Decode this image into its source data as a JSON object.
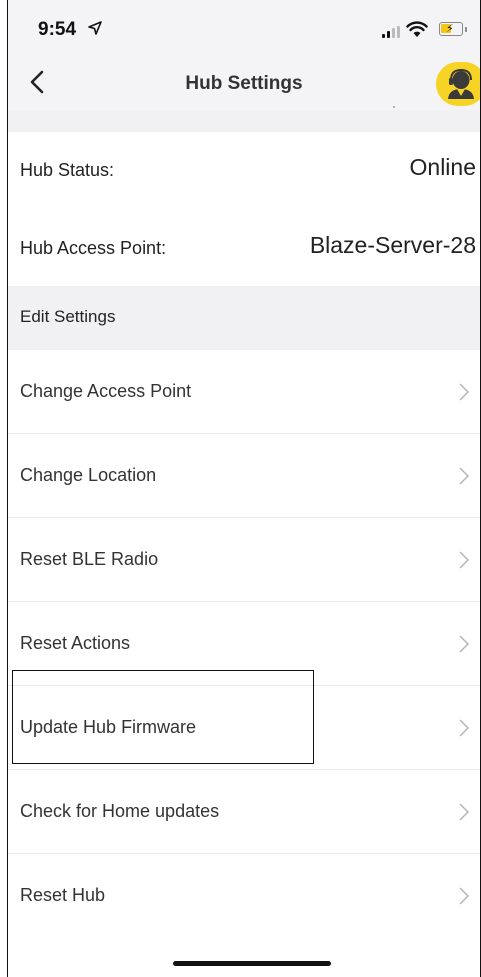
{
  "status_bar": {
    "time": "9:54"
  },
  "nav": {
    "title": "Hub Settings"
  },
  "info": [
    {
      "label": "Hub Status:",
      "value": "Online"
    },
    {
      "label": "Hub Access Point:",
      "value": "Blaze-Server-28"
    }
  ],
  "section_header": "Edit Settings",
  "menu": [
    {
      "label": "Change Access Point"
    },
    {
      "label": "Change Location"
    },
    {
      "label": "Reset BLE Radio"
    },
    {
      "label": "Reset Actions"
    },
    {
      "label": "Update Hub Firmware"
    },
    {
      "label": "Check for Home updates"
    },
    {
      "label": "Reset Hub"
    }
  ],
  "colors": {
    "accent": "#f7d325",
    "background": "#f1f1f3"
  }
}
